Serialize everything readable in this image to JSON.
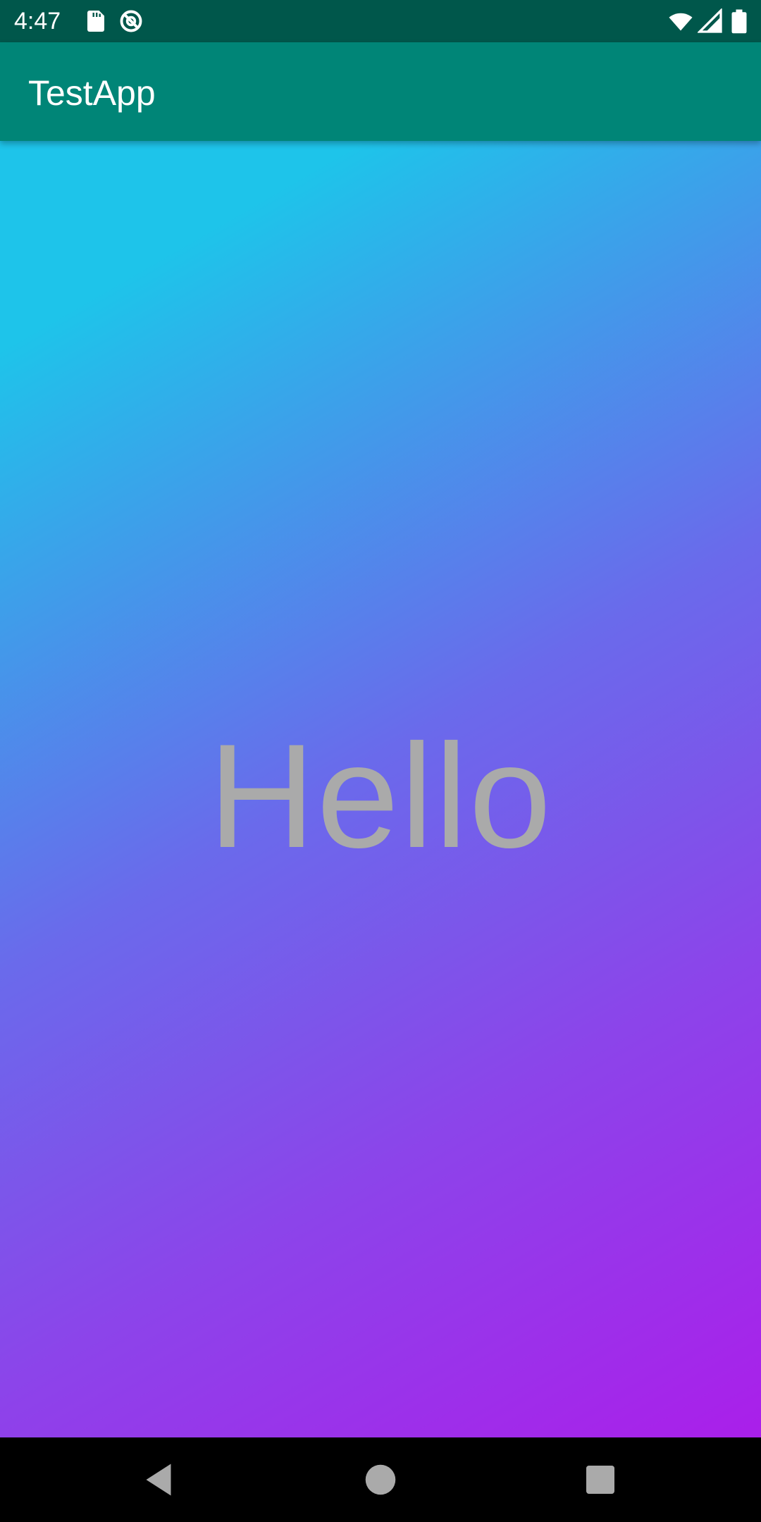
{
  "status_bar": {
    "time": "4:47",
    "icons": [
      "sd-card-icon",
      "sync-icon",
      "wifi-icon",
      "signal-icon",
      "battery-icon"
    ],
    "background_color": "#00574b"
  },
  "app_bar": {
    "title": "TestApp",
    "background_color": "#008577"
  },
  "content": {
    "greeting": "Hello",
    "gradient_colors": [
      "#1ec4ea",
      "#6a6aeb",
      "#aa1fea"
    ],
    "text_color": "#aaaaaa"
  },
  "nav_bar": {
    "buttons": [
      "back-icon",
      "home-icon",
      "recents-icon"
    ]
  }
}
